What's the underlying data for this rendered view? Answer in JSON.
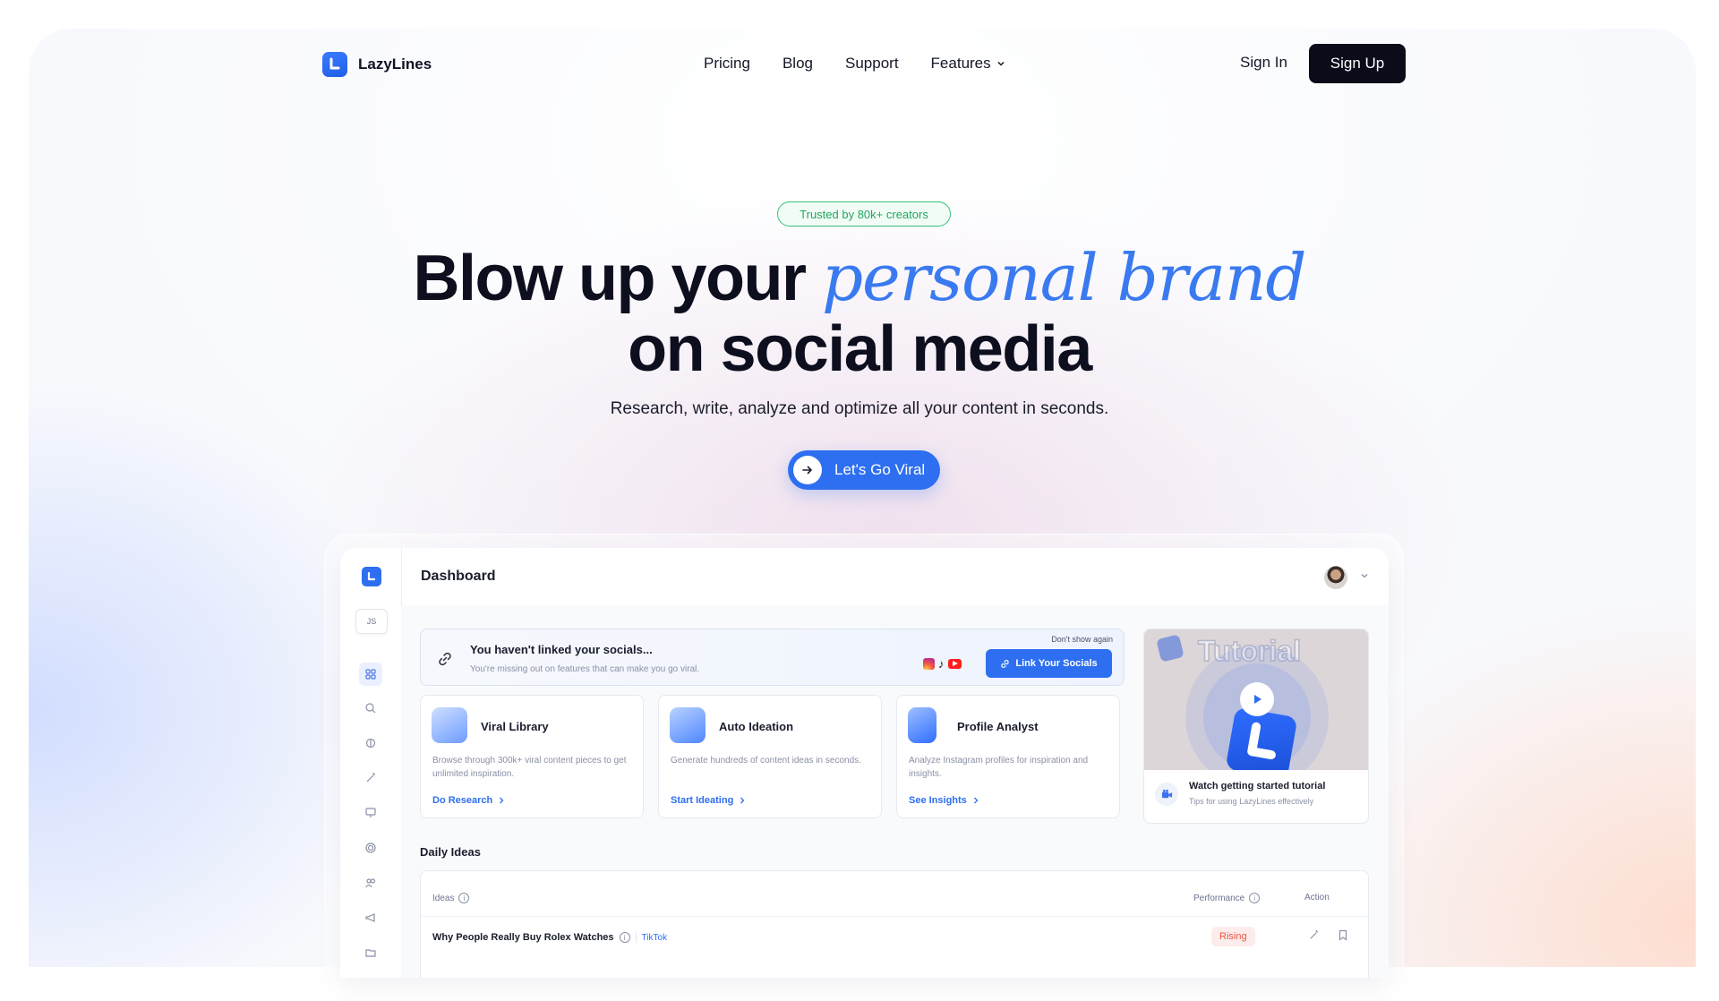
{
  "nav": {
    "brand": "LazyLines",
    "links": [
      "Pricing",
      "Blog",
      "Support",
      "Features"
    ],
    "sign_in": "Sign In",
    "sign_up": "Sign Up"
  },
  "hero": {
    "badge": "Trusted by 80k+ creators",
    "headline_start": "Blow up your ",
    "headline_accent": "personal brand",
    "headline_line2": "on social media",
    "subheadline": "Research, write, analyze and optimize all your content in seconds.",
    "cta": "Let's Go Viral"
  },
  "dashboard": {
    "title": "Dashboard",
    "user_initials": "JS",
    "banner": {
      "title": "You haven't linked your socials...",
      "description": "You're missing out on features that can make you go viral.",
      "dismiss": "Don't show again",
      "button": "Link Your Socials"
    },
    "cards": [
      {
        "title": "Viral Library",
        "description": "Browse through 300k+ viral content pieces to get unlimited inspiration.",
        "link": "Do Research"
      },
      {
        "title": "Auto Ideation",
        "description": "Generate hundreds of content ideas in seconds.",
        "link": "Start Ideating"
      },
      {
        "title": "Profile Analyst",
        "description": "Analyze Instagram profiles for inspiration and insights.",
        "link": "See Insights"
      }
    ],
    "tutorial": {
      "image_text": "Tutorial",
      "title": "Watch getting started tutorial",
      "description": "Tips for using LazyLines effectively"
    },
    "daily_ideas": {
      "title": "Daily Ideas",
      "columns": [
        "Ideas",
        "Performance",
        "Action"
      ],
      "rows": [
        {
          "idea": "Why People Really Buy Rolex Watches",
          "platform": "TikTok",
          "performance": "Rising"
        }
      ]
    },
    "colors": {
      "accent": "#2d6ff0",
      "rising": "#e6553f",
      "badge_green": "#1fa85e"
    }
  }
}
